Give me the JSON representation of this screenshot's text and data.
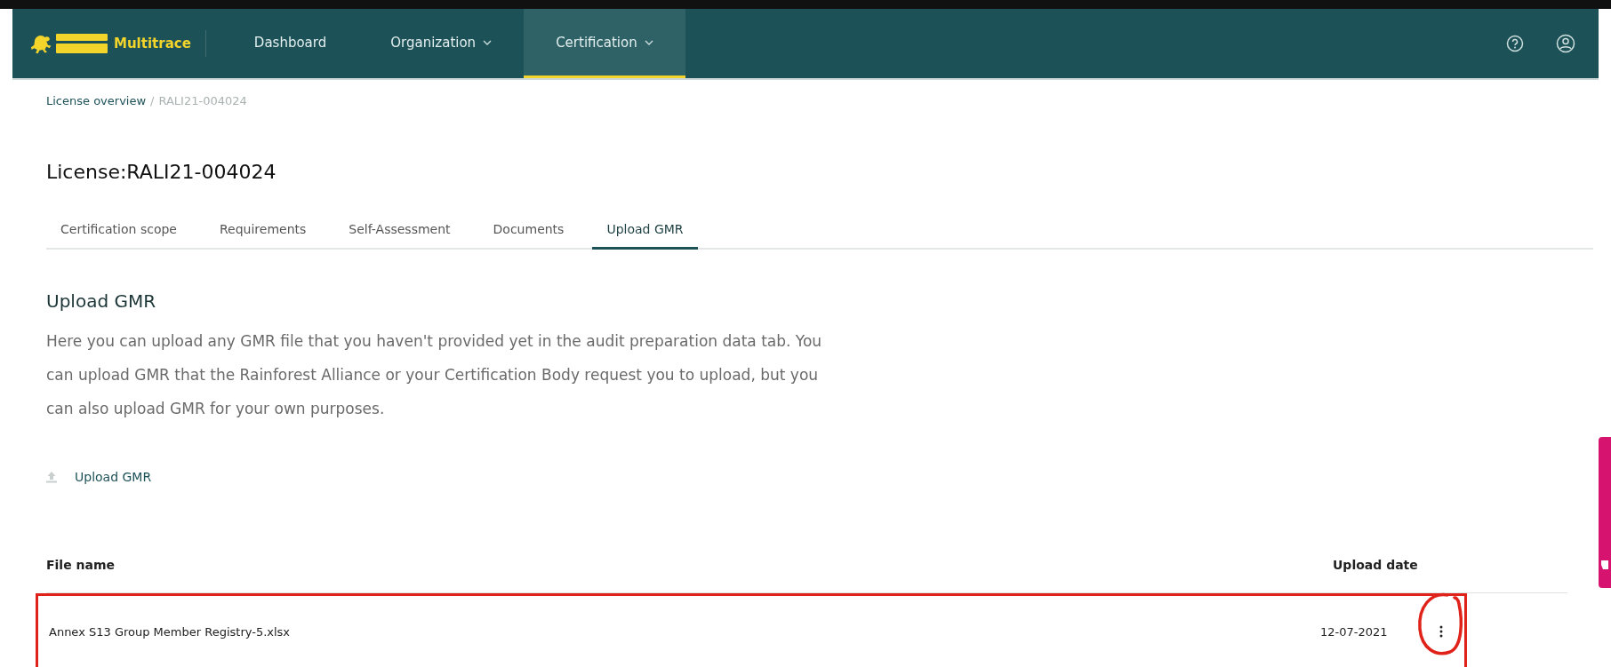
{
  "header": {
    "brand": "Multitrace",
    "nav": [
      {
        "label": "Dashboard",
        "dropdown": false,
        "selected": false
      },
      {
        "label": "Organization",
        "dropdown": true,
        "selected": false
      },
      {
        "label": "Certification",
        "dropdown": true,
        "selected": true
      }
    ]
  },
  "breadcrumb": {
    "link": "License overview",
    "separator": "/",
    "current": "RALI21-004024"
  },
  "title": "License:RALI21-004024",
  "tabs": [
    {
      "label": "Certification scope",
      "selected": false
    },
    {
      "label": "Requirements",
      "selected": false
    },
    {
      "label": "Self-Assessment",
      "selected": false
    },
    {
      "label": "Documents",
      "selected": false
    },
    {
      "label": "Upload GMR",
      "selected": true
    }
  ],
  "section": {
    "heading": "Upload GMR",
    "description": "Here you can upload any GMR file that you haven't provided yet in the audit preparation data tab. You can upload GMR that the Rainforest Alliance or your Certification Body request you to upload, but you can also upload GMR for your own purposes.",
    "upload_action": "Upload GMR"
  },
  "table": {
    "columns": [
      "File name",
      "Upload date"
    ],
    "rows": [
      {
        "file_name": "Annex S13 Group Member Registry-5.xlsx",
        "upload_date": "12-07-2021",
        "highlighted": true
      }
    ]
  }
}
